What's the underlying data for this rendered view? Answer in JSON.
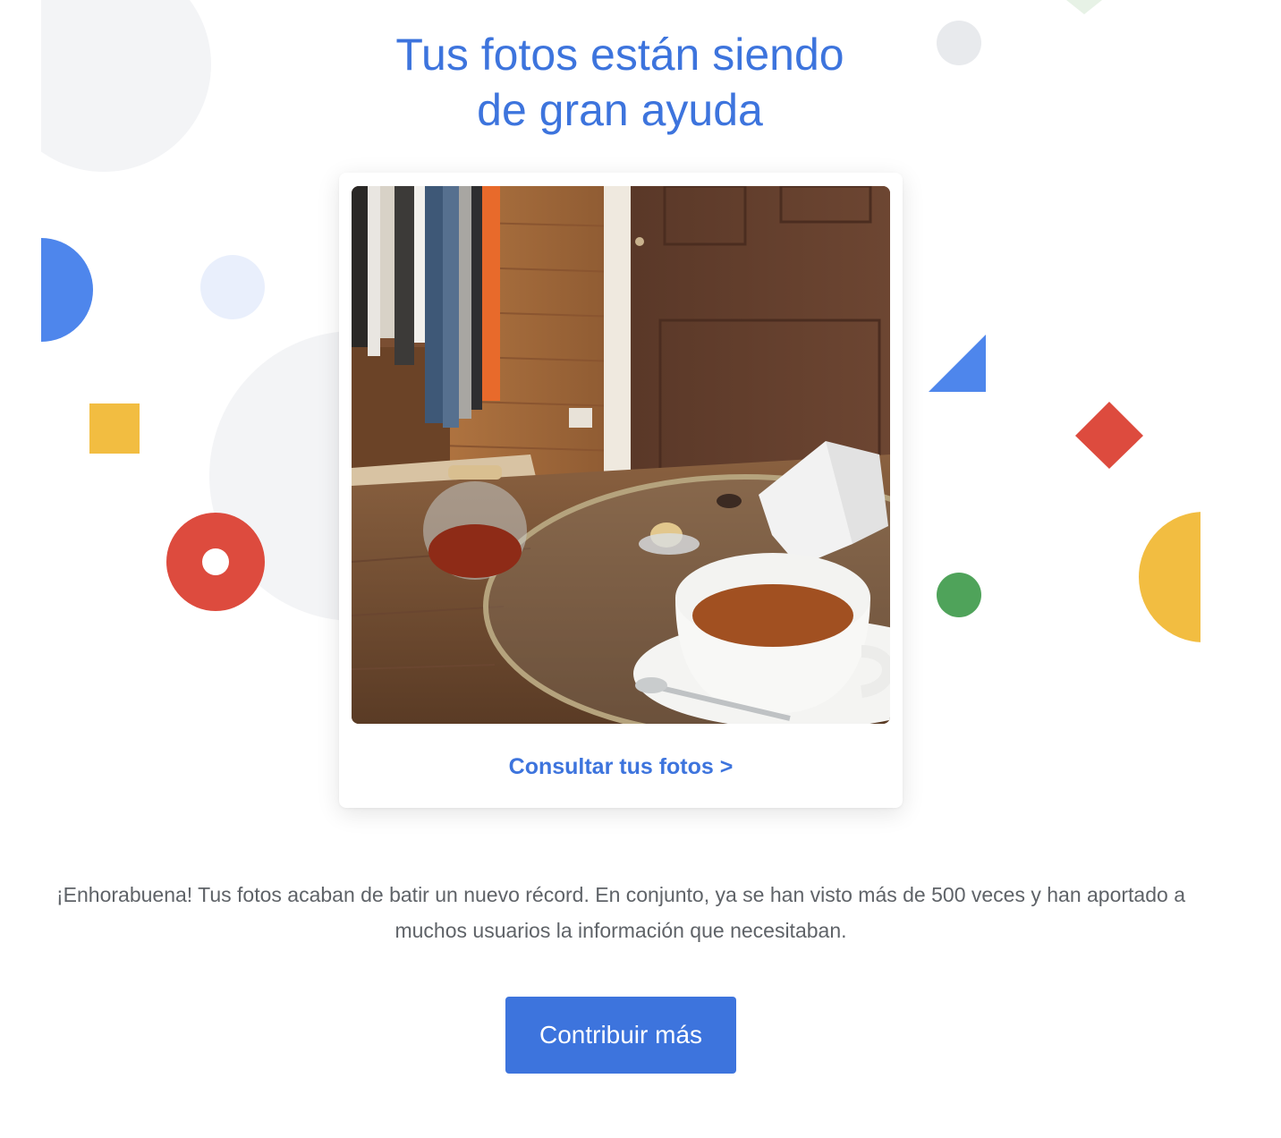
{
  "header": {
    "title_line1": "Tus fotos están siendo",
    "title_line2": "de gran ayuda"
  },
  "card": {
    "image_alt": "Foto de una taza de té sobre una mesa de cristal en una tienda con ropa colgada",
    "link_label": "Consultar tus fotos >"
  },
  "message": {
    "text": "¡Enhorabuena! Tus fotos acaban de batir un nuevo récord. En conjunto, ya se han visto más de 500 veces y han aportado a muchos usuarios la información que necesitaban."
  },
  "cta": {
    "label": "Contribuir más"
  },
  "colors": {
    "accent_blue": "#3d74dd",
    "google_blue": "#4e86ec",
    "google_red": "#dd4b3e",
    "google_yellow": "#f2bd41",
    "google_green": "#4fa35a",
    "pale_grey": "#f3f4f6",
    "body_text": "#5f6368"
  },
  "decorations": [
    "grey-circle-large",
    "blue-half-circle",
    "pale-blue-circle",
    "yellow-square",
    "red-ring",
    "grey-circle-small",
    "blue-triangle",
    "red-diamond",
    "green-circle",
    "yellow-half-circle",
    "green-diamond-partial"
  ]
}
